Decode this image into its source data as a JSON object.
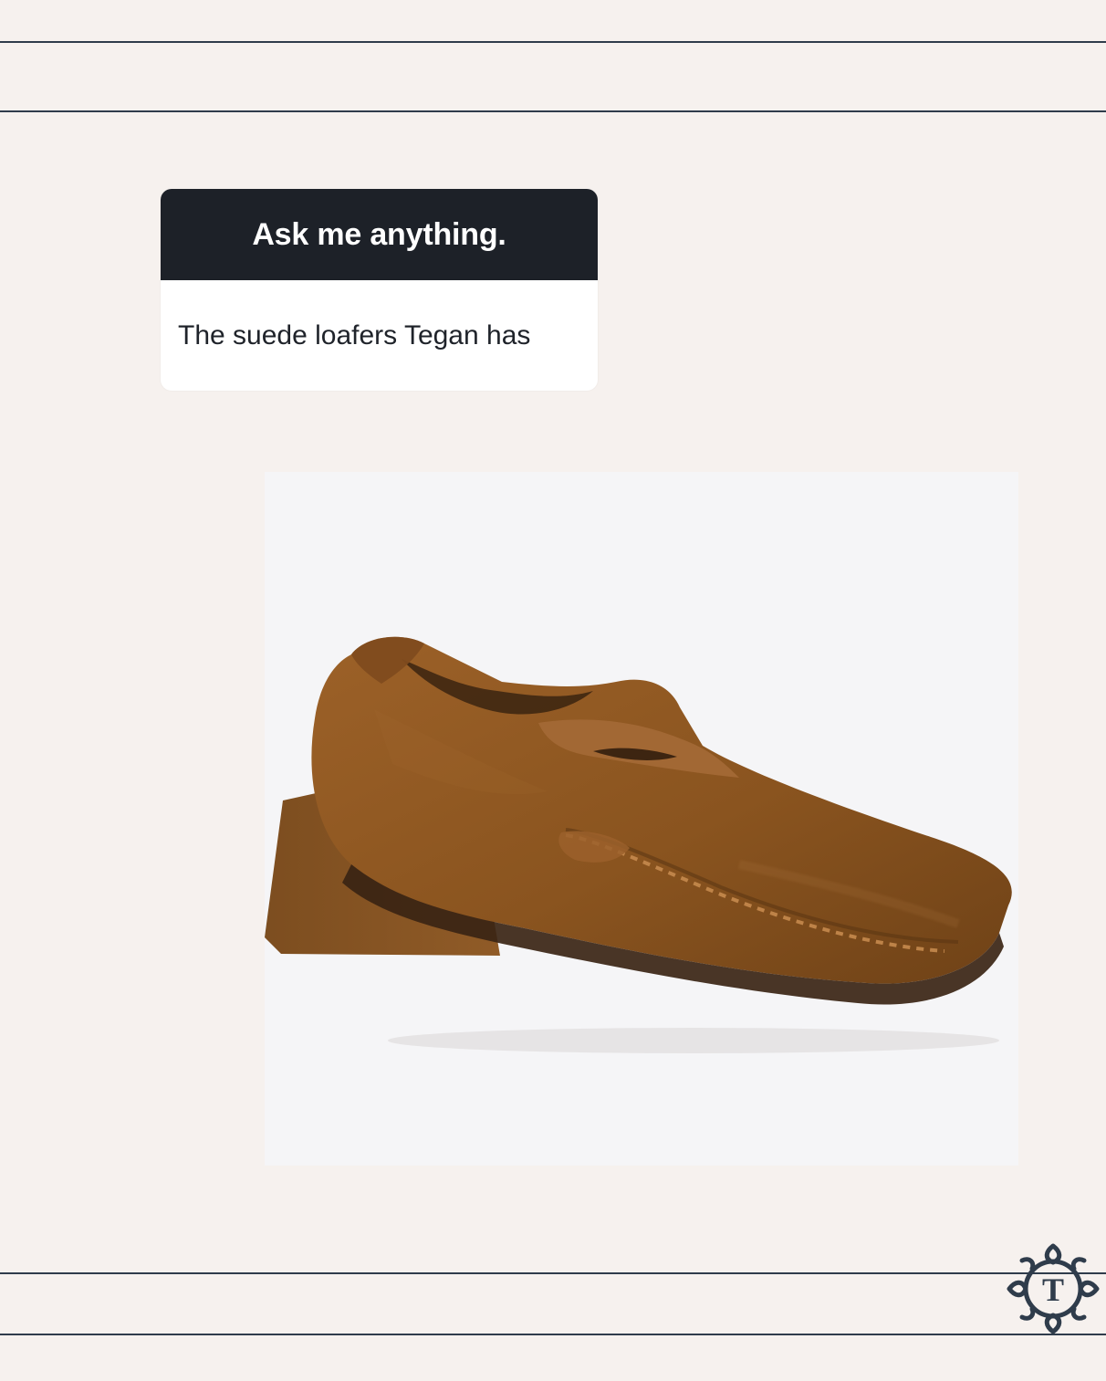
{
  "question_card": {
    "prompt": "Ask me anything.",
    "answer": "The suede loafers Tegan has"
  },
  "product_image": {
    "subject": "suede-penny-loafer-block-heel",
    "color": "#8d5624"
  },
  "logo": {
    "monogram": "T"
  },
  "colors": {
    "background": "#f6f1ee",
    "rule": "#2f3c4b",
    "card_header": "#1d2128",
    "logo": "#2f3c4b"
  }
}
